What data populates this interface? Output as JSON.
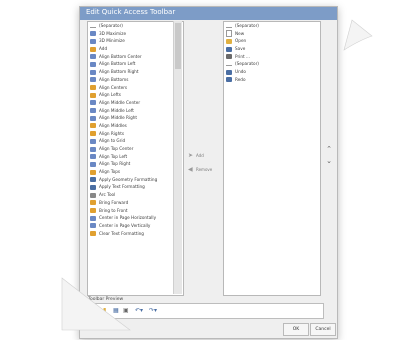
{
  "dialog": {
    "title": "Edit Quick Access Toolbar",
    "left_items": [
      {
        "label": "(Separator)",
        "icon": "separator-icon",
        "color": "#9a9a9a"
      },
      {
        "label": "3D Maximize",
        "icon": "maximize-icon",
        "color": "#6a88c4"
      },
      {
        "label": "3D Minimize",
        "icon": "minimize-icon",
        "color": "#6a88c4"
      },
      {
        "label": "Add",
        "icon": "add-icon",
        "color": "#e0a030"
      },
      {
        "label": "Align Bottom Center",
        "icon": "align-icon",
        "color": "#6a88c4"
      },
      {
        "label": "Align Bottom Left",
        "icon": "align-icon",
        "color": "#6a88c4"
      },
      {
        "label": "Align Bottom Right",
        "icon": "align-icon",
        "color": "#6a88c4"
      },
      {
        "label": "Align Bottoms",
        "icon": "align-icon",
        "color": "#6a88c4"
      },
      {
        "label": "Align Centers",
        "icon": "align-icon",
        "color": "#e0a030"
      },
      {
        "label": "Align Lefts",
        "icon": "align-icon",
        "color": "#e0a030"
      },
      {
        "label": "Align Middle Center",
        "icon": "align-icon",
        "color": "#6a88c4"
      },
      {
        "label": "Align Middle Left",
        "icon": "align-icon",
        "color": "#6a88c4"
      },
      {
        "label": "Align Middle Right",
        "icon": "align-icon",
        "color": "#6a88c4"
      },
      {
        "label": "Align Middles",
        "icon": "align-icon",
        "color": "#e0a030"
      },
      {
        "label": "Align Rights",
        "icon": "align-icon",
        "color": "#e0a030"
      },
      {
        "label": "Align to Grid",
        "icon": "grid-icon",
        "color": "#6a88c4"
      },
      {
        "label": "Align Top Center",
        "icon": "align-icon",
        "color": "#6a88c4"
      },
      {
        "label": "Align Top Left",
        "icon": "align-icon",
        "color": "#6a88c4"
      },
      {
        "label": "Align Top Right",
        "icon": "align-icon",
        "color": "#6a88c4"
      },
      {
        "label": "Align Tops",
        "icon": "align-icon",
        "color": "#e0a030"
      },
      {
        "label": "Apply Geometry Formatting",
        "icon": "brush-icon",
        "color": "#4a6ea3"
      },
      {
        "label": "Apply Text Formatting",
        "icon": "brush-icon",
        "color": "#4a6ea3"
      },
      {
        "label": "Arc Tool",
        "icon": "arc-icon",
        "color": "#888888"
      },
      {
        "label": "Bring Forward",
        "icon": "bring-forward-icon",
        "color": "#e0a030"
      },
      {
        "label": "Bring to Front",
        "icon": "bring-front-icon",
        "color": "#e0a030"
      },
      {
        "label": "Center in Page Horizontally",
        "icon": "center-icon",
        "color": "#6a88c4"
      },
      {
        "label": "Center in Page Vertically",
        "icon": "center-icon",
        "color": "#6a88c4"
      },
      {
        "label": "Clear Text Formatting",
        "icon": "clear-icon",
        "color": "#e0a030"
      }
    ],
    "right_items": [
      {
        "label": "(Separator)",
        "icon": "separator-icon",
        "color": "#9a9a9a"
      },
      {
        "label": "New",
        "icon": "new-icon",
        "color": "#ffffff"
      },
      {
        "label": "Open",
        "icon": "open-icon",
        "color": "#e0b040"
      },
      {
        "label": "Save",
        "icon": "save-icon",
        "color": "#4a6ea3"
      },
      {
        "label": "Print ...",
        "icon": "print-icon",
        "color": "#6a6a6a"
      },
      {
        "label": "(Separator)",
        "icon": "separator-icon",
        "color": "#9a9a9a"
      },
      {
        "label": "Undo",
        "icon": "undo-icon",
        "color": "#4a6ea3"
      },
      {
        "label": "Redo",
        "icon": "redo-icon",
        "color": "#4a6ea3"
      }
    ],
    "add_label": "Add",
    "remove_label": "Remove",
    "preview_label": "Toolbar Preview",
    "ok_label": "OK",
    "cancel_label": "Cancel"
  },
  "colors": {
    "title_bar": "#7d9cc7",
    "dialog_bg": "#efefef"
  }
}
